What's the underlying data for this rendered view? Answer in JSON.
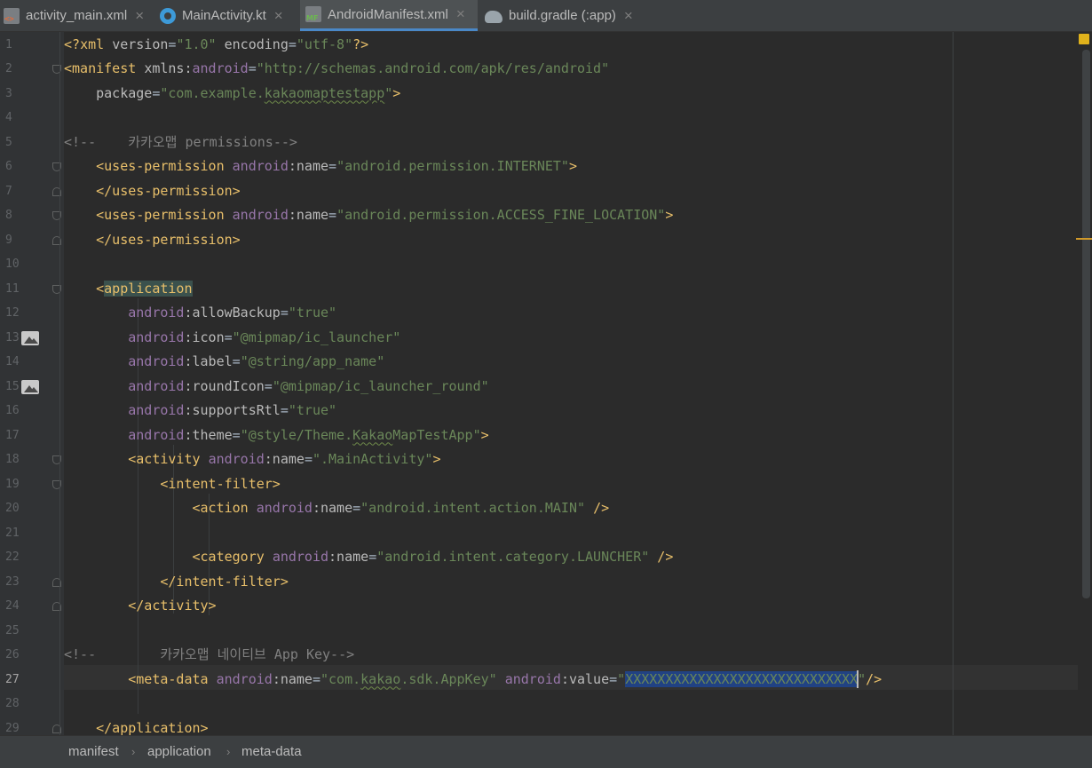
{
  "tabs": [
    {
      "label": "activity_main.xml",
      "icon": "xml-file-icon",
      "active": false
    },
    {
      "label": "MainActivity.kt",
      "icon": "kotlin-file-icon",
      "active": false
    },
    {
      "label": "AndroidManifest.xml",
      "icon": "manifest-file-icon",
      "active": true
    },
    {
      "label": "build.gradle (:app)",
      "icon": "gradle-file-icon",
      "active": false
    }
  ],
  "close_glyph": "×",
  "editor": {
    "current_line": 27,
    "line_numbers": [
      "1",
      "2",
      "3",
      "4",
      "5",
      "6",
      "7",
      "8",
      "9",
      "10",
      "11",
      "12",
      "13",
      "14",
      "15",
      "16",
      "17",
      "18",
      "19",
      "20",
      "21",
      "22",
      "23",
      "24",
      "25",
      "26",
      "27",
      "28",
      "29"
    ],
    "lines": [
      [
        [
          "prolog",
          "<?"
        ],
        [
          "prolog",
          "xml "
        ],
        [
          "attr",
          "version"
        ],
        [
          "plain",
          "="
        ],
        [
          "val",
          "\"1.0\""
        ],
        [
          "plain",
          " "
        ],
        [
          "attr",
          "encoding"
        ],
        [
          "plain",
          "="
        ],
        [
          "val",
          "\"utf-8\""
        ],
        [
          "prolog",
          "?>"
        ]
      ],
      [
        [
          "tag",
          "<manifest "
        ],
        [
          "attr",
          "xmlns:"
        ],
        [
          "ns",
          "android"
        ],
        [
          "plain",
          "="
        ],
        [
          "val",
          "\"http://schemas.android.com/apk/res/android\""
        ]
      ],
      [
        [
          "plain",
          "    "
        ],
        [
          "attr",
          "package"
        ],
        [
          "plain",
          "="
        ],
        [
          "val",
          "\"com.example."
        ],
        [
          "valsq",
          "kakaomaptestapp"
        ],
        [
          "val",
          "\""
        ],
        [
          "tag",
          ">"
        ]
      ],
      [],
      [
        [
          "com",
          "<!--    카카오맵 permissions-->"
        ]
      ],
      [
        [
          "plain",
          "    "
        ],
        [
          "tag",
          "<uses-permission "
        ],
        [
          "ns",
          "android"
        ],
        [
          "attr",
          ":name"
        ],
        [
          "plain",
          "="
        ],
        [
          "val",
          "\"android.permission.INTERNET\""
        ],
        [
          "tag",
          ">"
        ]
      ],
      [
        [
          "plain",
          "    "
        ],
        [
          "tag",
          "</uses-permission>"
        ]
      ],
      [
        [
          "plain",
          "    "
        ],
        [
          "tag",
          "<uses-permission "
        ],
        [
          "ns",
          "android"
        ],
        [
          "attr",
          ":name"
        ],
        [
          "plain",
          "="
        ],
        [
          "val",
          "\"android.permission.ACCESS_FINE_LOCATION\""
        ],
        [
          "tag",
          ">"
        ]
      ],
      [
        [
          "plain",
          "    "
        ],
        [
          "tag",
          "</uses-permission>"
        ]
      ],
      [],
      [
        [
          "plain",
          "    "
        ],
        [
          "tag",
          "<"
        ],
        [
          "taghl",
          "application"
        ]
      ],
      [
        [
          "plain",
          "        "
        ],
        [
          "ns",
          "android"
        ],
        [
          "attr",
          ":allowBackup"
        ],
        [
          "plain",
          "="
        ],
        [
          "val",
          "\"true\""
        ]
      ],
      [
        [
          "plain",
          "        "
        ],
        [
          "ns",
          "android"
        ],
        [
          "attr",
          ":icon"
        ],
        [
          "plain",
          "="
        ],
        [
          "val",
          "\"@mipmap/ic_launcher\""
        ]
      ],
      [
        [
          "plain",
          "        "
        ],
        [
          "ns",
          "android"
        ],
        [
          "attr",
          ":label"
        ],
        [
          "plain",
          "="
        ],
        [
          "val",
          "\"@string/app_name\""
        ]
      ],
      [
        [
          "plain",
          "        "
        ],
        [
          "ns",
          "android"
        ],
        [
          "attr",
          ":roundIcon"
        ],
        [
          "plain",
          "="
        ],
        [
          "val",
          "\"@mipmap/ic_launcher_round\""
        ]
      ],
      [
        [
          "plain",
          "        "
        ],
        [
          "ns",
          "android"
        ],
        [
          "attr",
          ":supportsRtl"
        ],
        [
          "plain",
          "="
        ],
        [
          "val",
          "\"true\""
        ]
      ],
      [
        [
          "plain",
          "        "
        ],
        [
          "ns",
          "android"
        ],
        [
          "attr",
          ":theme"
        ],
        [
          "plain",
          "="
        ],
        [
          "val",
          "\"@style/Theme."
        ],
        [
          "valsq",
          "Kakao"
        ],
        [
          "val",
          "MapTestApp\""
        ],
        [
          "tag",
          ">"
        ]
      ],
      [
        [
          "plain",
          "        "
        ],
        [
          "tag",
          "<activity "
        ],
        [
          "ns",
          "android"
        ],
        [
          "attr",
          ":name"
        ],
        [
          "plain",
          "="
        ],
        [
          "val",
          "\".MainActivity\""
        ],
        [
          "tag",
          ">"
        ]
      ],
      [
        [
          "plain",
          "            "
        ],
        [
          "tag",
          "<intent-filter>"
        ]
      ],
      [
        [
          "plain",
          "                "
        ],
        [
          "tag",
          "<action "
        ],
        [
          "ns",
          "android"
        ],
        [
          "attr",
          ":name"
        ],
        [
          "plain",
          "="
        ],
        [
          "val",
          "\"android.intent.action.MAIN\""
        ],
        [
          "plain",
          " "
        ],
        [
          "tag",
          "/>"
        ]
      ],
      [],
      [
        [
          "plain",
          "                "
        ],
        [
          "tag",
          "<category "
        ],
        [
          "ns",
          "android"
        ],
        [
          "attr",
          ":name"
        ],
        [
          "plain",
          "="
        ],
        [
          "val",
          "\"android.intent.category.LAUNCHER\""
        ],
        [
          "plain",
          " "
        ],
        [
          "tag",
          "/>"
        ]
      ],
      [
        [
          "plain",
          "            "
        ],
        [
          "tag",
          "</intent-filter>"
        ]
      ],
      [
        [
          "plain",
          "        "
        ],
        [
          "tag",
          "</activity>"
        ]
      ],
      [],
      [
        [
          "com",
          "<!--        카카오맵 네이티브 App Key-->"
        ]
      ],
      [
        [
          "plain",
          "        "
        ],
        [
          "tag",
          "<meta-data "
        ],
        [
          "ns",
          "android"
        ],
        [
          "attr",
          ":name"
        ],
        [
          "plain",
          "="
        ],
        [
          "val",
          "\"com."
        ],
        [
          "valsq",
          "kakao"
        ],
        [
          "val",
          ".sdk.AppKey\""
        ],
        [
          "plain",
          " "
        ],
        [
          "ns",
          "android"
        ],
        [
          "attr",
          ":value"
        ],
        [
          "plain",
          "="
        ],
        [
          "val",
          "\""
        ],
        [
          "sel",
          "XXXXXXXXXXXXXXXXXXXXXXXXXXXXX"
        ],
        [
          "cursor",
          ""
        ],
        [
          "val",
          "\""
        ],
        [
          "tag",
          "/>"
        ]
      ],
      [],
      [
        [
          "plain",
          "    "
        ],
        [
          "tag",
          "</application>"
        ]
      ]
    ]
  },
  "breadcrumb": [
    "manifest",
    "application",
    "meta-data"
  ],
  "breadcrumb_separator": "›",
  "colors": {
    "background": "#2b2b2b",
    "tag": "#e8bf6a",
    "namespace": "#9876aa",
    "attribute": "#bababa",
    "value": "#6a8759",
    "comment": "#808080",
    "selection": "#214283",
    "active_tab_underline": "#4a88c7"
  }
}
